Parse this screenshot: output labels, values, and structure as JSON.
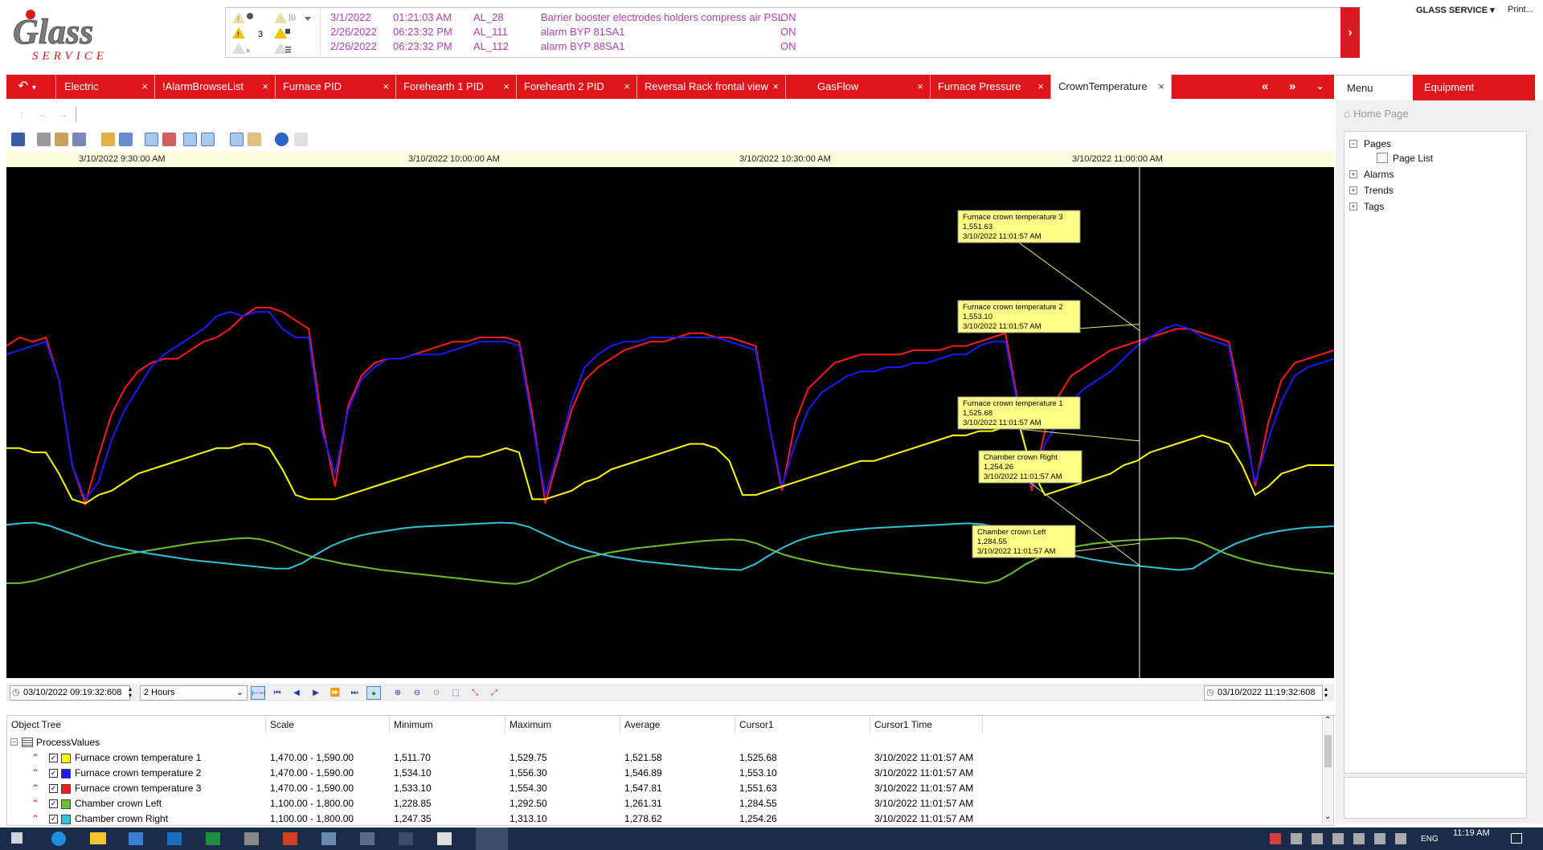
{
  "header": {
    "logo": {
      "text": "Glass",
      "subtext": "SERVICE"
    },
    "user_menu": "GLASS SERVICE",
    "print_label": "Print...",
    "alarm_indicators": [
      {
        "count": ""
      },
      {
        "count": "3"
      },
      {
        "count": ""
      }
    ],
    "alarms": [
      {
        "date": "3/1/2022",
        "time": "01:21:03 AM",
        "id": "AL_28",
        "desc": "Barrier booster electrodes holders compress air PSL",
        "state": "ON"
      },
      {
        "date": "2/26/2022",
        "time": "06:23:32 PM",
        "id": "AL_111",
        "desc": "alarm BYP 81SA1",
        "state": "ON"
      },
      {
        "date": "2/26/2022",
        "time": "06:23:32 PM",
        "id": "AL_112",
        "desc": "alarm BYP 88SA1",
        "state": "ON"
      }
    ],
    "alarm_color": "#b23eb2"
  },
  "tabs": [
    {
      "label": "Electric"
    },
    {
      "label": "!AlarmBrowseList"
    },
    {
      "label": "Furnace PID"
    },
    {
      "label": "Forehearth 1 PID"
    },
    {
      "label": "Forehearth 2 PID"
    },
    {
      "label": "Reversal Rack frontal view"
    },
    {
      "label": "GasFlow"
    },
    {
      "label": "Furnace Pressure"
    },
    {
      "label": "CrownTemperature",
      "active": true
    }
  ],
  "tab_close_glyph": "×",
  "side_panel": {
    "menu_tab": "Menu",
    "equipment_tab": "Equipment",
    "home_page": "Home Page",
    "tree": [
      {
        "label": "Pages",
        "expanded": true,
        "children": [
          {
            "label": "Page List"
          }
        ]
      },
      {
        "label": "Alarms",
        "expanded": false
      },
      {
        "label": "Trends",
        "expanded": false
      },
      {
        "label": "Tags",
        "expanded": false
      }
    ]
  },
  "time_axis": {
    "labels": [
      "3/10/2022 9:30:00 AM",
      "3/10/2022 10:00:00 AM",
      "3/10/2022 10:30:00 AM",
      "3/10/2022 11:00:00 AM"
    ]
  },
  "range_bar": {
    "start": "03/10/2022 09:19:32:608",
    "duration": "2 Hours",
    "end": "03/10/2022 11:19:32:608"
  },
  "tooltips": [
    {
      "name": "Furnace crown temperature 3",
      "value": "1,551.63",
      "time": "3/10/2022 11:01:57 AM"
    },
    {
      "name": "Furnace crown temperature 2",
      "value": "1,553.10",
      "time": "3/10/2022 11:01:57 AM"
    },
    {
      "name": "Furnace crown temperature 1",
      "value": "1,525.68",
      "time": "3/10/2022 11:01:57 AM"
    },
    {
      "name": "Chamber crown Right",
      "value": "1,254.26",
      "time": "3/10/2022 11:01:57 AM"
    },
    {
      "name": "Chamber crown Left",
      "value": "1,284.55",
      "time": "3/10/2022 11:01:57 AM"
    }
  ],
  "grid": {
    "headers": [
      "Object Tree",
      "Scale",
      "Minimum",
      "Maximum",
      "Average",
      "Cursor1",
      "Cursor1 Time"
    ],
    "group": "ProcessValues",
    "rows": [
      {
        "name": "Furnace crown temperature 1",
        "color": "#ffff00",
        "scale": "1,470.00 - 1,590.00",
        "min": "1,511.70",
        "max": "1,529.75",
        "avg": "1,521.58",
        "cursor": "1,525.68",
        "ctime": "3/10/2022 11:01:57 AM"
      },
      {
        "name": "Furnace crown temperature 2",
        "color": "#1a1aff",
        "scale": "1,470.00 - 1,590.00",
        "min": "1,534.10",
        "max": "1,556.30",
        "avg": "1,546.89",
        "cursor": "1,553.10",
        "ctime": "3/10/2022 11:01:57 AM"
      },
      {
        "name": "Furnace crown temperature 3",
        "color": "#ff1a1a",
        "scale": "1,470.00 - 1,590.00",
        "min": "1,533.10",
        "max": "1,554.30",
        "avg": "1,547.81",
        "cursor": "1,551.63",
        "ctime": "3/10/2022 11:01:57 AM"
      },
      {
        "name": "Chamber crown Left",
        "color": "#6cc02a",
        "scale": "1,100.00 - 1,800.00",
        "min": "1,228.85",
        "max": "1,292.50",
        "avg": "1,261.31",
        "cursor": "1,284.55",
        "ctime": "3/10/2022 11:01:57 AM"
      },
      {
        "name": "Chamber crown Right",
        "color": "#2ec4d8",
        "scale": "1,100.00 - 1,800.00",
        "min": "1,247.35",
        "max": "1,313.10",
        "avg": "1,278.62",
        "cursor": "1,254.26",
        "ctime": "3/10/2022 11:01:57 AM"
      }
    ]
  },
  "chart_data": {
    "type": "line",
    "x_range": [
      "3/10/2022 9:19:32 AM",
      "3/10/2022 11:19:32 AM"
    ],
    "cursor_time": "3/10/2022 11:01:57 AM",
    "series": [
      {
        "name": "Furnace crown temperature 3",
        "color": "#ff1a1a",
        "ylim": [
          1470,
          1590
        ],
        "values": [
          1548,
          1550,
          1549,
          1550,
          1540,
          1520,
          1511,
          1522,
          1532,
          1538,
          1542,
          1544,
          1545,
          1545,
          1547,
          1549,
          1550,
          1552,
          1555,
          1557,
          1557,
          1556,
          1554,
          1552,
          1530,
          1515,
          1534,
          1541,
          1544,
          1545,
          1545,
          1546,
          1547,
          1548,
          1549,
          1549,
          1550,
          1550,
          1550,
          1549,
          1532,
          1511,
          1522,
          1533,
          1540,
          1543,
          1545,
          1547,
          1548,
          1549,
          1549,
          1550,
          1551,
          1551,
          1550,
          1550,
          1549,
          1548,
          1530,
          1514,
          1530,
          1538,
          1541,
          1544,
          1545,
          1546,
          1546,
          1546,
          1546,
          1547,
          1547,
          1547,
          1548,
          1548,
          1549,
          1550,
          1551,
          1534,
          1514,
          1528,
          1536,
          1541,
          1543,
          1545,
          1547,
          1548,
          1549,
          1550,
          1551,
          1552,
          1552,
          1551,
          1550,
          1549,
          1534,
          1515,
          1530,
          1540,
          1544,
          1545,
          1546,
          1547
        ]
      },
      {
        "name": "Furnace crown temperature 2",
        "color": "#1a1aff",
        "ylim": [
          1470,
          1590
        ],
        "values": [
          1546,
          1547,
          1548,
          1549,
          1540,
          1520,
          1512,
          1516,
          1526,
          1533,
          1538,
          1543,
          1546,
          1548,
          1550,
          1552,
          1555,
          1556,
          1555,
          1556,
          1556,
          1552,
          1550,
          1550,
          1528,
          1518,
          1533,
          1540,
          1543,
          1545,
          1545,
          1546,
          1546,
          1546,
          1547,
          1548,
          1549,
          1549,
          1549,
          1548,
          1530,
          1513,
          1523,
          1535,
          1543,
          1546,
          1548,
          1549,
          1549,
          1550,
          1550,
          1550,
          1550,
          1550,
          1550,
          1549,
          1548,
          1547,
          1530,
          1515,
          1525,
          1533,
          1537,
          1539,
          1541,
          1542,
          1542,
          1543,
          1543,
          1544,
          1544,
          1545,
          1546,
          1546,
          1548,
          1549,
          1549,
          1533,
          1515,
          1525,
          1530,
          1535,
          1538,
          1540,
          1542,
          1545,
          1548,
          1550,
          1552,
          1553,
          1552,
          1550,
          1549,
          1548,
          1531,
          1516,
          1526,
          1535,
          1541,
          1543,
          1544,
          1545
        ]
      },
      {
        "name": "Furnace crown temperature 1",
        "color": "#ffff00",
        "ylim": [
          1470,
          1590
        ],
        "values": [
          1524,
          1524,
          1523,
          1523,
          1518,
          1512,
          1511,
          1513,
          1514,
          1516,
          1518,
          1519,
          1520,
          1521,
          1522,
          1523,
          1524,
          1524,
          1525,
          1525,
          1524,
          1519,
          1513,
          1512,
          1512,
          1512,
          1513,
          1514,
          1515,
          1516,
          1517,
          1518,
          1519,
          1520,
          1521,
          1522,
          1522,
          1523,
          1524,
          1523,
          1512,
          1512,
          1513,
          1514,
          1516,
          1517,
          1519,
          1520,
          1521,
          1522,
          1523,
          1524,
          1525,
          1525,
          1524,
          1521,
          1513,
          1513,
          1514,
          1515,
          1516,
          1517,
          1518,
          1519,
          1520,
          1521,
          1521,
          1522,
          1523,
          1524,
          1525,
          1526,
          1527,
          1527,
          1528,
          1528,
          1529,
          1530,
          1519,
          1513,
          1514,
          1515,
          1516,
          1517,
          1518,
          1520,
          1521,
          1523,
          1524,
          1525,
          1526,
          1527,
          1526,
          1525,
          1520,
          1513,
          1515,
          1518,
          1519,
          1520,
          1520,
          1520
        ]
      },
      {
        "name": "Chamber crown Left",
        "color": "#6cc02a",
        "ylim": [
          1100,
          1800
        ],
        "values": [
          1230,
          1230,
          1233,
          1238,
          1244,
          1250,
          1256,
          1261,
          1266,
          1270,
          1273,
          1276,
          1279,
          1282,
          1285,
          1287,
          1289,
          1291,
          1292,
          1290,
          1285,
          1278,
          1271,
          1265,
          1261,
          1257,
          1254,
          1251,
          1248,
          1246,
          1244,
          1242,
          1240,
          1238,
          1236,
          1234,
          1232,
          1230,
          1229,
          1233,
          1241,
          1250,
          1258,
          1264,
          1268,
          1272,
          1275,
          1278,
          1280,
          1282,
          1284,
          1286,
          1288,
          1289,
          1290,
          1289,
          1284,
          1276,
          1269,
          1264,
          1260,
          1256,
          1253,
          1250,
          1248,
          1246,
          1244,
          1242,
          1240,
          1238,
          1236,
          1234,
          1232,
          1230,
          1234,
          1244,
          1256,
          1265,
          1272,
          1277,
          1281,
          1284,
          1286,
          1288,
          1289,
          1290,
          1291,
          1292,
          1291,
          1286,
          1278,
          1270,
          1264,
          1259,
          1255,
          1252,
          1249,
          1247,
          1245,
          1243
        ]
      },
      {
        "name": "Chamber crown Right",
        "color": "#2ec4d8",
        "ylim": [
          1100,
          1800
        ],
        "values": [
          1310,
          1312,
          1313,
          1309,
          1302,
          1295,
          1288,
          1282,
          1278,
          1274,
          1271,
          1268,
          1265,
          1262,
          1260,
          1258,
          1256,
          1254,
          1252,
          1250,
          1250,
          1258,
          1270,
          1281,
          1289,
          1295,
          1299,
          1302,
          1305,
          1307,
          1308,
          1309,
          1310,
          1311,
          1312,
          1313,
          1312,
          1307,
          1298,
          1289,
          1281,
          1275,
          1270,
          1266,
          1263,
          1260,
          1258,
          1256,
          1254,
          1252,
          1250,
          1249,
          1248,
          1256,
          1268,
          1279,
          1288,
          1294,
          1298,
          1301,
          1303,
          1305,
          1306,
          1307,
          1308,
          1309,
          1310,
          1311,
          1312,
          1311,
          1307,
          1300,
          1292,
          1284,
          1277,
          1271,
          1266,
          1262,
          1259,
          1256,
          1254,
          1252,
          1250,
          1248,
          1250,
          1262,
          1274,
          1284,
          1291,
          1297,
          1301,
          1304,
          1306,
          1307,
          1308
        ]
      }
    ]
  },
  "taskbar": {
    "time": "11:19 AM",
    "lang": "ENG"
  }
}
